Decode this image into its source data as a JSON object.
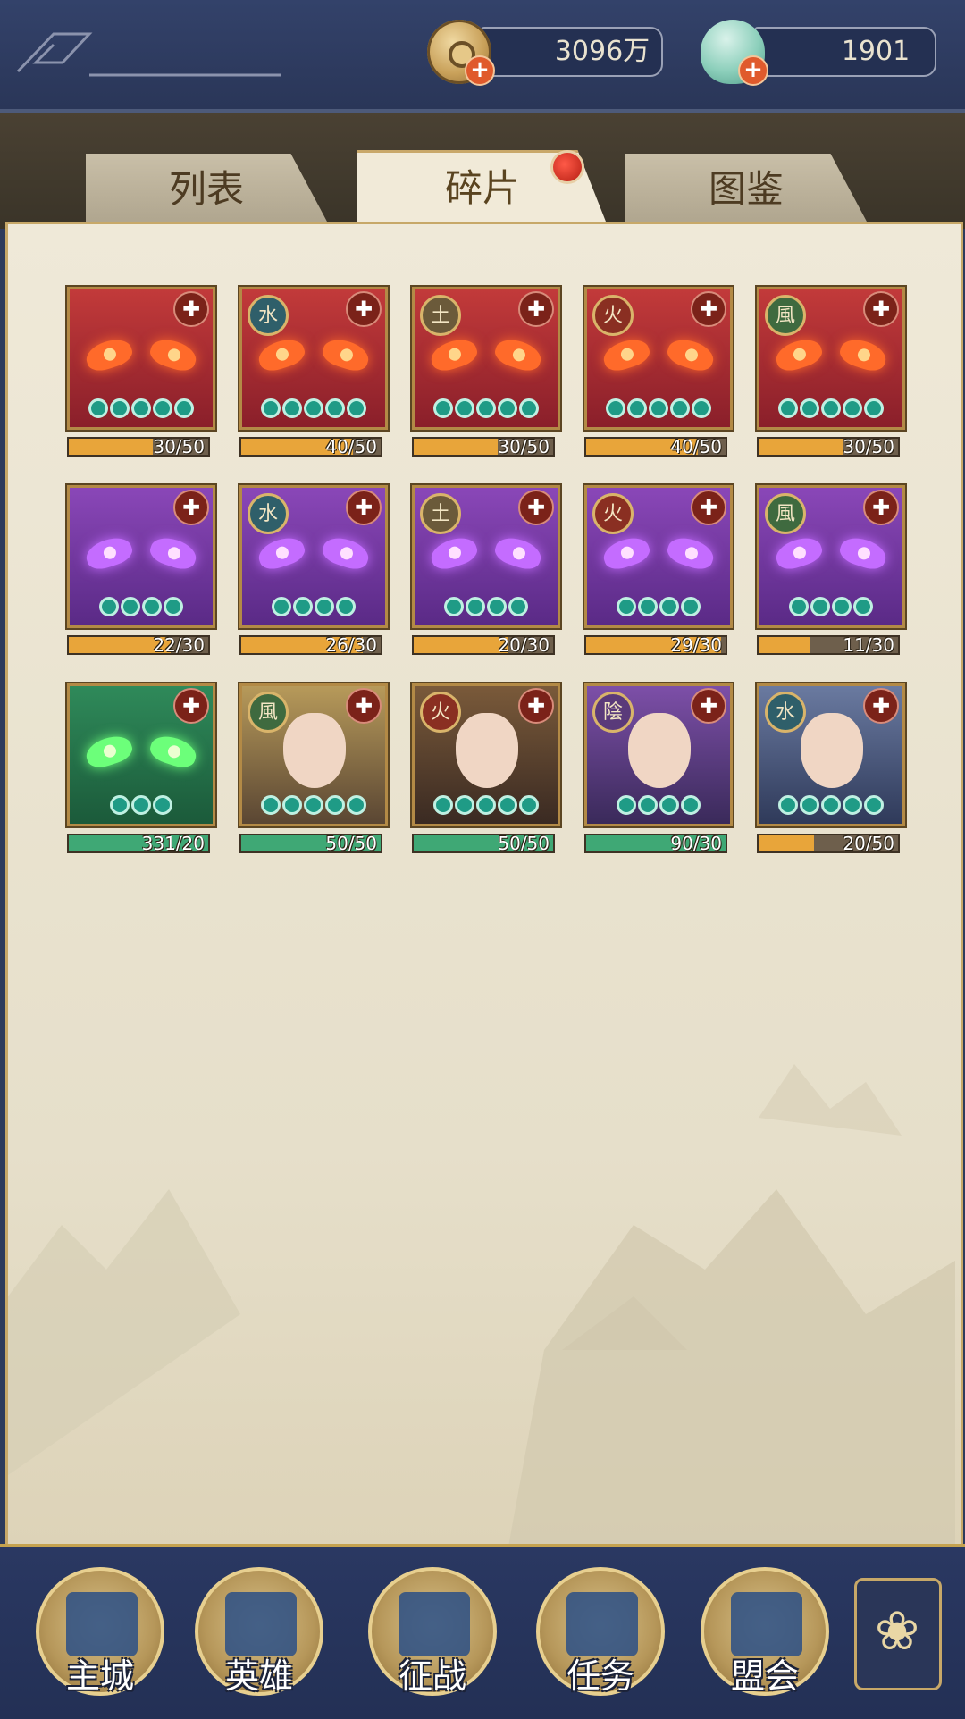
{
  "currency": {
    "coins": "3096万",
    "gems": "1901"
  },
  "tabs": [
    {
      "label": "列表",
      "active": false
    },
    {
      "label": "碎片",
      "active": true
    },
    {
      "label": "图鉴",
      "active": false
    }
  ],
  "fragments": [
    [
      {
        "type": "red-mask",
        "element": "",
        "stars": 5,
        "progress": "30/50",
        "fill": 0.6,
        "bar": "orange"
      },
      {
        "type": "red-mask",
        "element": "水",
        "stars": 5,
        "progress": "40/50",
        "fill": 0.8,
        "bar": "orange"
      },
      {
        "type": "red-mask",
        "element": "土",
        "stars": 5,
        "progress": "30/50",
        "fill": 0.6,
        "bar": "orange"
      },
      {
        "type": "red-mask",
        "element": "火",
        "stars": 5,
        "progress": "40/50",
        "fill": 0.8,
        "bar": "orange"
      },
      {
        "type": "red-mask",
        "element": "風",
        "stars": 5,
        "progress": "30/50",
        "fill": 0.6,
        "bar": "orange"
      }
    ],
    [
      {
        "type": "purple-mask",
        "element": "",
        "stars": 4,
        "progress": "22/30",
        "fill": 0.73,
        "bar": "orange"
      },
      {
        "type": "purple-mask",
        "element": "水",
        "stars": 4,
        "progress": "26/30",
        "fill": 0.87,
        "bar": "orange"
      },
      {
        "type": "purple-mask",
        "element": "土",
        "stars": 4,
        "progress": "20/30",
        "fill": 0.67,
        "bar": "orange"
      },
      {
        "type": "purple-mask",
        "element": "火",
        "stars": 4,
        "progress": "29/30",
        "fill": 0.97,
        "bar": "orange"
      },
      {
        "type": "purple-mask",
        "element": "風",
        "stars": 4,
        "progress": "11/30",
        "fill": 0.37,
        "bar": "orange"
      }
    ],
    [
      {
        "type": "green-mask",
        "element": "",
        "stars": 3,
        "progress": "331/20",
        "fill": 1,
        "bar": "green"
      },
      {
        "type": "hero-lady",
        "element": "風",
        "stars": 5,
        "progress": "50/50",
        "fill": 1,
        "bar": "green"
      },
      {
        "type": "hero-masked",
        "element": "火",
        "stars": 5,
        "progress": "50/50",
        "fill": 1,
        "bar": "green"
      },
      {
        "type": "hero-purple",
        "element": "陰",
        "stars": 4,
        "progress": "90/30",
        "fill": 1,
        "bar": "green"
      },
      {
        "type": "hero-silver",
        "element": "水",
        "stars": 5,
        "progress": "20/50",
        "fill": 0.4,
        "bar": "orange"
      }
    ]
  ],
  "nav": [
    {
      "label": "主城",
      "icon": "palace-icon"
    },
    {
      "label": "英雄",
      "icon": "hero-portrait-icon"
    },
    {
      "label": "征战",
      "icon": "horn-icon"
    },
    {
      "label": "任务",
      "icon": "scroll-bell-icon"
    },
    {
      "label": "盟会",
      "icon": "gate-icon"
    }
  ],
  "menu_icon": "clover-menu-icon",
  "colors": {
    "bar_orange": "#e8a53a",
    "bar_green": "#3fa875",
    "gold": "#c7a868",
    "navy": "#2d3b5c"
  }
}
